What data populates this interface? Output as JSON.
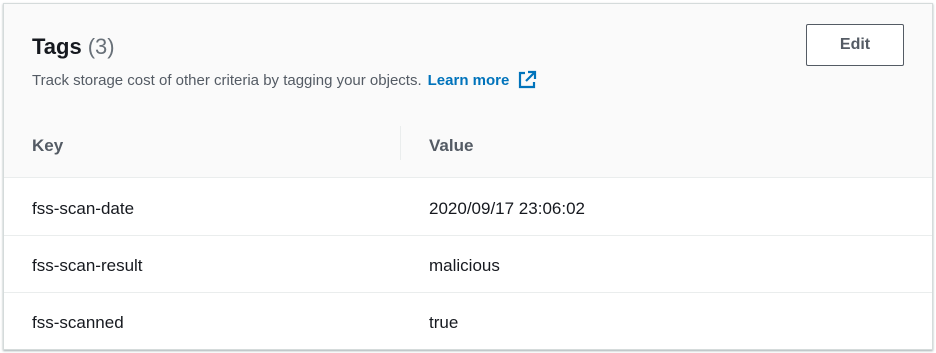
{
  "panel": {
    "title": "Tags",
    "count": "(3)",
    "description": "Track storage cost of other criteria by tagging your objects.",
    "learn_more": "Learn more",
    "edit_label": "Edit"
  },
  "table": {
    "headers": {
      "key": "Key",
      "value": "Value"
    },
    "rows": [
      {
        "key": "fss-scan-date",
        "value": "2020/09/17 23:06:02"
      },
      {
        "key": "fss-scan-result",
        "value": "malicious"
      },
      {
        "key": "fss-scanned",
        "value": "true"
      }
    ]
  },
  "colors": {
    "link": "#0073bb",
    "header_bg": "#fafafa",
    "text": "#16191f",
    "muted": "#545b64"
  },
  "icons": {
    "external": "external-link-icon"
  }
}
